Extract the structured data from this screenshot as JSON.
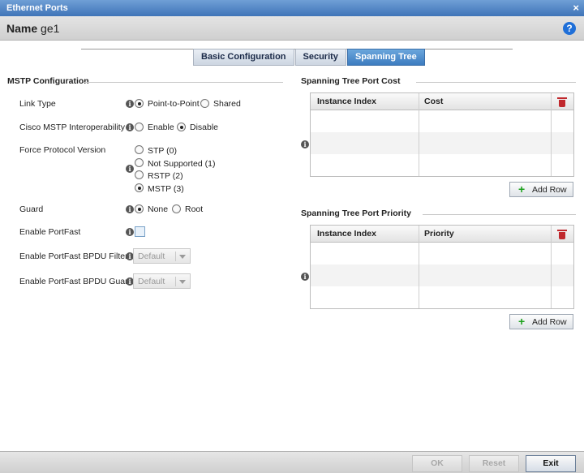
{
  "window": {
    "title": "Ethernet Ports",
    "close_glyph": "×"
  },
  "name_bar": {
    "label": "Name",
    "value": "ge1",
    "help_glyph": "?"
  },
  "tabs": [
    {
      "label": "Basic Configuration",
      "active": false
    },
    {
      "label": "Security",
      "active": false
    },
    {
      "label": "Spanning Tree",
      "active": true
    }
  ],
  "mstp": {
    "title": "MSTP Configuration",
    "link_type": {
      "label": "Link Type",
      "options": [
        "Point-to-Point",
        "Shared"
      ],
      "selected": "Point-to-Point"
    },
    "cisco": {
      "label": "Cisco MSTP Interoperability",
      "options": [
        "Enable",
        "Disable"
      ],
      "selected": "Disable"
    },
    "force_protocol": {
      "label": "Force Protocol Version",
      "options": [
        "STP (0)",
        "Not Supported (1)",
        "RSTP (2)",
        "MSTP (3)"
      ],
      "selected": "MSTP (3)"
    },
    "guard": {
      "label": "Guard",
      "options": [
        "None",
        "Root"
      ],
      "selected": "None"
    },
    "portfast": {
      "label": "Enable PortFast",
      "checked": false
    },
    "bpdu_filter": {
      "label": "Enable PortFast BPDU Filter",
      "value": "Default"
    },
    "bpdu_guard": {
      "label": "Enable PortFast BPDU Guard",
      "value": "Default"
    }
  },
  "port_cost": {
    "title": "Spanning Tree Port Cost",
    "columns": [
      "Instance Index",
      "Cost"
    ],
    "rows": [],
    "add_row_label": "Add Row"
  },
  "port_priority": {
    "title": "Spanning Tree Port Priority",
    "columns": [
      "Instance Index",
      "Priority"
    ],
    "rows": [],
    "add_row_label": "Add Row"
  },
  "footer": {
    "ok": "OK",
    "reset": "Reset",
    "exit": "Exit"
  },
  "colors": {
    "title_bar": "#3f74b8",
    "active_tab": "#3d7cc0",
    "delete_icon": "#c0282d",
    "add_icon": "#1aa01a"
  }
}
